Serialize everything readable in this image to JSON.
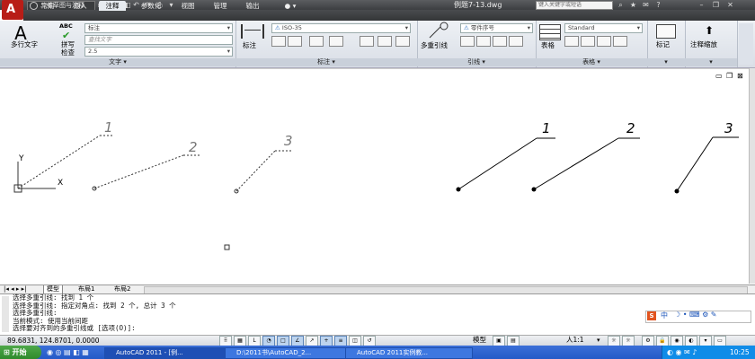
{
  "titlebar": {
    "workspace": "二维草图与注释",
    "doc_title": "例题7-13.dwg",
    "search_placeholder": "键入关键字或短语"
  },
  "tabs": [
    "常用",
    "插入",
    "注释",
    "参数化",
    "视图",
    "管理",
    "输出"
  ],
  "active_tab": "注释",
  "ribbon": {
    "text_panel": {
      "mtext_label": "多行文字",
      "spell_line1": "拼写",
      "spell_line2": "检查",
      "abc": "ABC",
      "style_value": "标注",
      "find_placeholder": "查找文字",
      "height_value": "2.5",
      "title": "文字"
    },
    "dim_panel": {
      "dim_label": "标注",
      "style_value": "ISO-35",
      "title": "标注"
    },
    "leader_panel": {
      "mleader_label": "多重引线",
      "style_value": "零件序号",
      "title": "引线"
    },
    "table_panel": {
      "table_label": "表格",
      "style_value": "Standard",
      "title": "表格"
    },
    "markup_panel": {
      "label": "标记"
    },
    "scale_panel": {
      "label": "注释缩放"
    }
  },
  "drawing": {
    "ucs_y": "Y",
    "ucs_x": "X",
    "leaders_dashed": [
      "1",
      "2",
      "3"
    ],
    "leaders_solid": [
      "1",
      "2",
      "3"
    ]
  },
  "layout_tabs": [
    "模型",
    "布局1",
    "布局2"
  ],
  "command_lines": [
    "选择多重引线: 找到 1 个",
    "选择多重引线: 指定对角点: 找到 2 个, 总计 3 个",
    "选择多重引线:",
    "当前模式: 使用当前间距",
    "选择要对齐到的多重引线或 [选项(O)]:"
  ],
  "status": {
    "coords": "89.6831,  124.8701,  0.0000",
    "model": "模型",
    "scale": "人1:1"
  },
  "taskbar": {
    "start": "开始",
    "tasks": [
      "AutoCAD 2011 - [例...",
      "D:\\2011书\\AutoCAD_2...",
      "AutoCAD 2011实例教..."
    ],
    "clock": "10:25"
  },
  "ime": {
    "lang": "中"
  }
}
